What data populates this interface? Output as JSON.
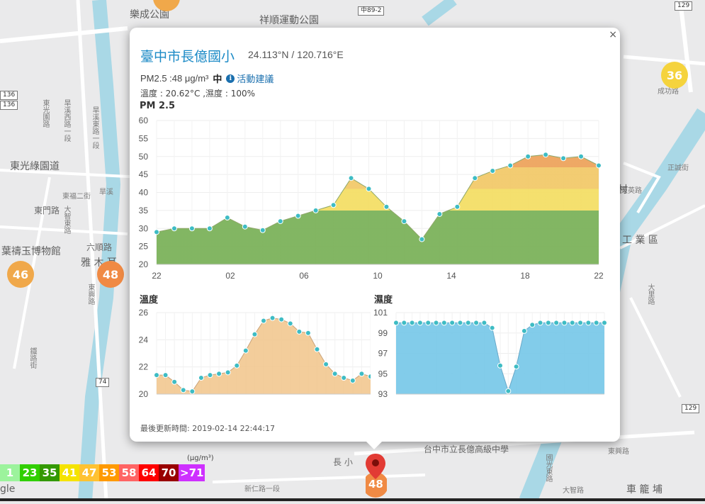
{
  "map": {
    "labels": [
      {
        "text": "樂成公園",
        "style": "big"
      },
      {
        "text": "祥順運動公園",
        "style": "big"
      },
      {
        "text": "東光綠園道",
        "style": "big"
      },
      {
        "text": "東門路",
        "style": ""
      },
      {
        "text": "葉禱玉博物館",
        "style": "big"
      },
      {
        "text": "六順路",
        "style": ""
      },
      {
        "text": "雅 木 耳",
        "style": "big"
      },
      {
        "text": "工 業 區",
        "style": "big"
      },
      {
        "text": "車 籠 埔",
        "style": "big"
      },
      {
        "text": "台中市立長億高級中學",
        "style": ""
      },
      {
        "text": "東光園路",
        "style": "road"
      },
      {
        "text": "旱溪西路一段",
        "style": "road"
      },
      {
        "text": "旱溪東路一段",
        "style": "road"
      },
      {
        "text": "大智東路",
        "style": "road"
      },
      {
        "text": "東福二街",
        "style": "road"
      },
      {
        "text": "成功路",
        "style": "road"
      },
      {
        "text": "正誠街",
        "style": "road"
      },
      {
        "text": "東英路",
        "style": "road"
      },
      {
        "text": "旱溪",
        "style": "road"
      },
      {
        "text": "國光東路",
        "style": "road"
      },
      {
        "text": "東興路",
        "style": "road"
      },
      {
        "text": "大里路",
        "style": "road"
      },
      {
        "text": "鐵路街",
        "style": "road"
      },
      {
        "text": "東興路",
        "style": "road"
      },
      {
        "text": "長 小",
        "style": ""
      },
      {
        "text": "新仁路一段",
        "style": "road"
      },
      {
        "text": "大智路",
        "style": "road"
      },
      {
        "text": "村",
        "style": "big"
      },
      {
        "text": "gle",
        "style": "big"
      }
    ],
    "shields": [
      "中89-2",
      "129",
      "129",
      "136",
      "136",
      "74"
    ],
    "clusters": [
      {
        "value": "36",
        "color": "#f5d33d"
      },
      {
        "value": "46",
        "color": "#f0a84a"
      },
      {
        "value": "48",
        "color": "#f08a44"
      },
      {
        "value": "48",
        "color": "#f08a44"
      }
    ]
  },
  "popup": {
    "close": "×",
    "station_name": "臺中市長億國小",
    "coords": "24.113°N / 120.716°E",
    "pm_text": "PM2.5 :48 μg/m³",
    "pm_level": "中",
    "advice_link": "活動建議",
    "info_icon": "i",
    "weather_text": "溫度 : 20.62°C ,濕度 : 100%",
    "pm_chart_title": "PM 2.5",
    "temp_chart_title": "溫度",
    "humidity_chart_title": "濕度",
    "updated": "最後更新時間: 2019-02-14 22:44:17"
  },
  "chart_data": [
    {
      "type": "area",
      "title": "PM 2.5",
      "x_ticks": [
        "22",
        "02",
        "06",
        "10",
        "14",
        "18",
        "22"
      ],
      "ylim": [
        20,
        60
      ],
      "y_ticks": [
        20,
        25,
        30,
        35,
        40,
        45,
        50,
        55,
        60
      ],
      "values": [
        29,
        30,
        30,
        30,
        33,
        30.5,
        29.5,
        32,
        33.5,
        35,
        36.5,
        44,
        41,
        36,
        32,
        27,
        34,
        36,
        44,
        46,
        47.5,
        50,
        50.5,
        49.5,
        50,
        47.5
      ],
      "fill_bands": [
        {
          "from": 20,
          "to": 35,
          "color": "#7cb25b"
        },
        {
          "from": 35,
          "to": 41,
          "color": "#f4de66"
        },
        {
          "from": 41,
          "to": 47,
          "color": "#f2c96a"
        },
        {
          "from": 47,
          "to": 60,
          "color": "#eda45d"
        }
      ],
      "grid": true
    },
    {
      "type": "area",
      "title": "溫度",
      "ylim": [
        20,
        26
      ],
      "y_ticks": [
        20,
        22,
        24,
        26
      ],
      "values": [
        21.4,
        21.4,
        20.9,
        20.3,
        20.2,
        21.2,
        21.4,
        21.5,
        21.6,
        22.1,
        23.2,
        24.4,
        25.4,
        25.6,
        25.5,
        25.2,
        24.6,
        24.5,
        23.3,
        22.2,
        21.5,
        21.2,
        21.0,
        21.5,
        21.3
      ],
      "color": "#f1c48a",
      "grid": true
    },
    {
      "type": "area",
      "title": "濕度",
      "ylim": [
        93,
        101
      ],
      "y_ticks": [
        93,
        95,
        97,
        99,
        101
      ],
      "values": [
        100,
        100,
        100,
        100,
        100,
        100,
        100,
        100,
        100,
        100,
        100,
        100,
        99.5,
        95.8,
        93.3,
        95.7,
        99.2,
        99.8,
        100,
        100,
        100,
        100,
        100,
        100,
        100,
        100,
        100
      ],
      "color": "#74c7e8",
      "grid": true
    }
  ],
  "legend": {
    "unit": "(μg/m³)",
    "items": [
      {
        "label": "1",
        "color": "#9cf39c",
        "text_color": "#ffffff"
      },
      {
        "label": "23",
        "color": "#31cf00",
        "text_color": "#ffffff"
      },
      {
        "label": "35",
        "color": "#339900",
        "text_color": "#ffffff"
      },
      {
        "label": "41",
        "color": "#f5e300",
        "text_color": "#ffffff"
      },
      {
        "label": "47",
        "color": "#ffc232",
        "text_color": "#ffffff"
      },
      {
        "label": "53",
        "color": "#ff9a00",
        "text_color": "#ffffff"
      },
      {
        "label": "58",
        "color": "#ff6464",
        "text_color": "#ffffff"
      },
      {
        "label": "64",
        "color": "#ff0000",
        "text_color": "#ffffff"
      },
      {
        "label": "70",
        "color": "#990000",
        "text_color": "#ffffff"
      },
      {
        "label": ">71",
        "color": "#ce30ff",
        "text_color": "#ffffff"
      }
    ]
  },
  "marker": {
    "value": "48"
  }
}
